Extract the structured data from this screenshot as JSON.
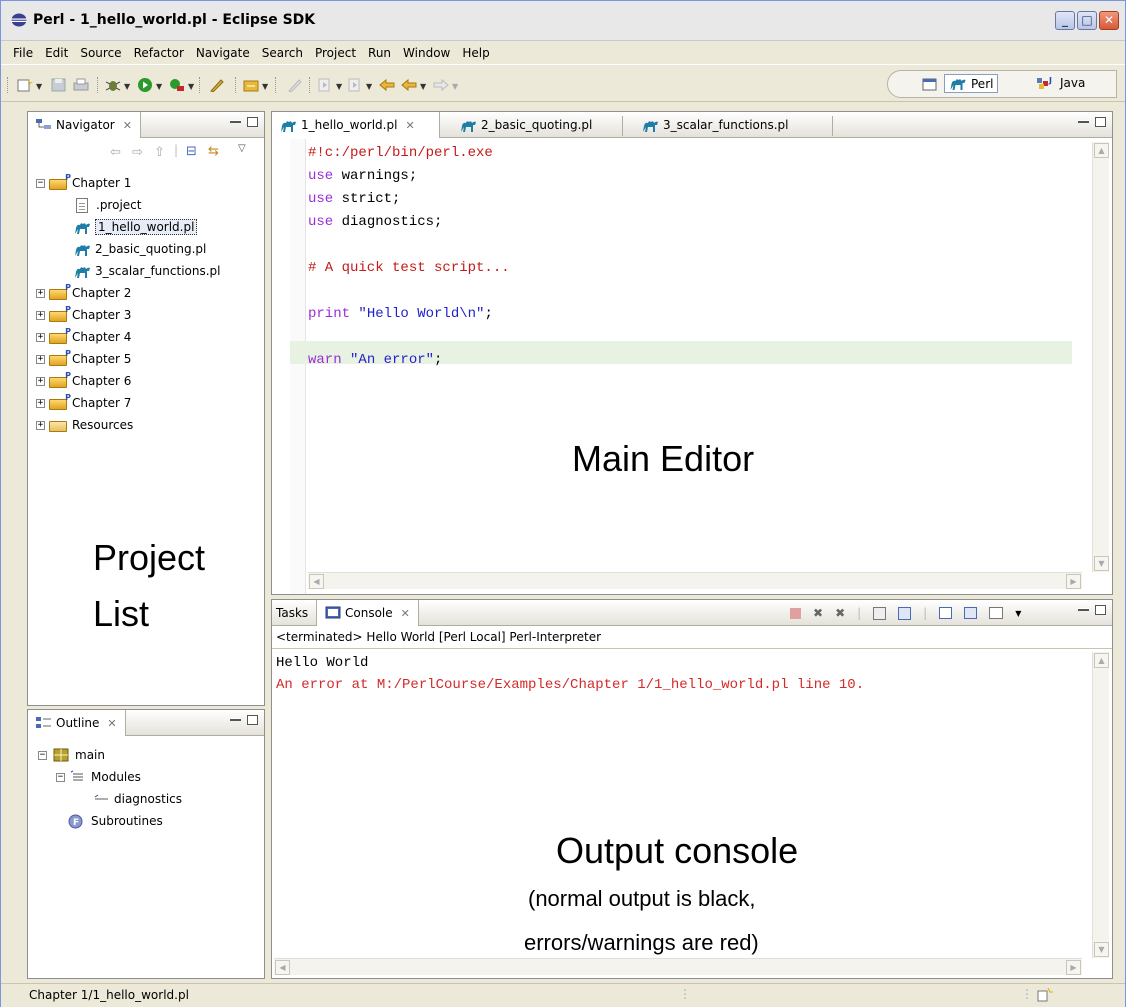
{
  "window": {
    "title": "Perl - 1_hello_world.pl - Eclipse SDK"
  },
  "menu": [
    "File",
    "Edit",
    "Source",
    "Refactor",
    "Navigate",
    "Search",
    "Project",
    "Run",
    "Window",
    "Help"
  ],
  "perspectives": {
    "perl": "Perl",
    "java": "Java"
  },
  "navigator": {
    "tab": "Navigator",
    "tree": {
      "chapter1": "Chapter 1",
      "chapter1_files": [
        ".project",
        "1_hello_world.pl",
        "2_basic_quoting.pl",
        "3_scalar_functions.pl"
      ],
      "others": [
        "Chapter 2",
        "Chapter 3",
        "Chapter 4",
        "Chapter 5",
        "Chapter 6",
        "Chapter 7"
      ],
      "resources": "Resources"
    },
    "annotation": [
      "Project",
      "List"
    ]
  },
  "outline": {
    "tab": "Outline",
    "main": "main",
    "modules": "Modules",
    "diagnostics": "diagnostics",
    "subroutines": "Subroutines"
  },
  "editor": {
    "tabs": [
      "1_hello_world.pl",
      "2_basic_quoting.pl",
      "3_scalar_functions.pl"
    ],
    "lines": {
      "l1": "#!c:/perl/bin/perl.exe",
      "l2_kw": "use",
      "l2_rest": " warnings;",
      "l3_kw": "use",
      "l3_rest": " strict;",
      "l4_kw": "use",
      "l4_rest": " diagnostics;",
      "l6": "# A quick test script...",
      "l8_kw": "print",
      "l8_str": " \"Hello World\\n\"",
      "l8_end": ";",
      "l10_kw": "warn",
      "l10_str": " \"An error\"",
      "l10_end": ";"
    },
    "annotation": "Main Editor"
  },
  "console": {
    "tabs": {
      "tasks": "Tasks",
      "console": "Console"
    },
    "header": "<terminated> Hello World [Perl Local] Perl-Interpreter",
    "output": "Hello World",
    "error": "An error at M:/PerlCourse/Examples/Chapter 1/1_hello_world.pl line 10.",
    "annotation_title": "Output console",
    "annotation_sub1": "(normal output is black,",
    "annotation_sub2": "errors/warnings are red)"
  },
  "status": {
    "path": "Chapter 1/1_hello_world.pl"
  },
  "colors": {
    "keyword": "#9a2dd8",
    "string": "#2222cc",
    "comment": "#c41a1a",
    "error": "#d42a2a",
    "current_line": "#e8f2e2"
  }
}
